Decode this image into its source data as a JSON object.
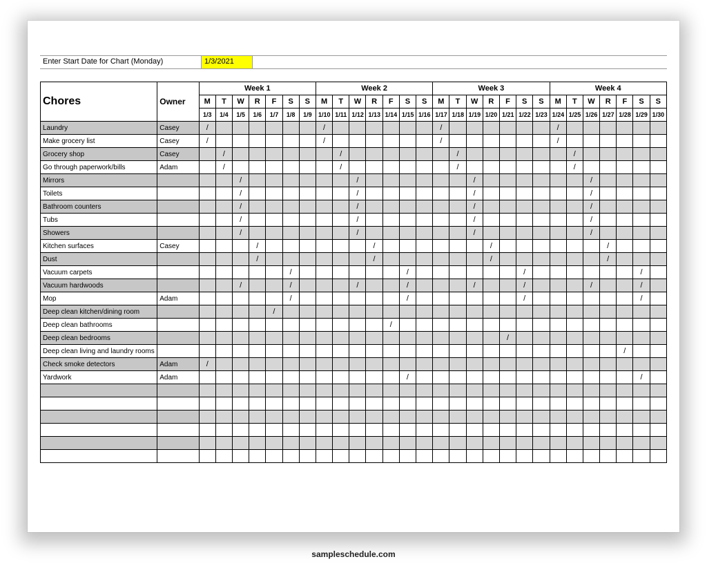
{
  "top": {
    "label": "Enter Start Date for Chart (Monday)",
    "date": "1/3/2021"
  },
  "headers": {
    "chores": "Chores",
    "owner": "Owner",
    "weeks": [
      "Week 1",
      "Week 2",
      "Week 3",
      "Week 4"
    ],
    "day_letters": [
      "M",
      "T",
      "W",
      "R",
      "F",
      "S",
      "S",
      "M",
      "T",
      "W",
      "R",
      "F",
      "S",
      "S",
      "M",
      "T",
      "W",
      "R",
      "F",
      "S",
      "S",
      "M",
      "T",
      "W",
      "R",
      "F",
      "S",
      "S"
    ],
    "day_dates": [
      "1/3",
      "1/4",
      "1/5",
      "1/6",
      "1/7",
      "1/8",
      "1/9",
      "1/10",
      "1/11",
      "1/12",
      "1/13",
      "1/14",
      "1/15",
      "1/16",
      "1/17",
      "1/18",
      "1/19",
      "1/20",
      "1/21",
      "1/22",
      "1/23",
      "1/24",
      "1/25",
      "1/26",
      "1/27",
      "1/28",
      "1/29",
      "1/30"
    ]
  },
  "rows": [
    {
      "chore": "Laundry",
      "owner": "Casey",
      "shaded": true,
      "marks": [
        0,
        7,
        14,
        21
      ]
    },
    {
      "chore": "Make grocery list",
      "owner": "Casey",
      "shaded": false,
      "marks": [
        0,
        7,
        14,
        21
      ]
    },
    {
      "chore": "Grocery shop",
      "owner": "Casey",
      "shaded": true,
      "marks": [
        1,
        8,
        15,
        22
      ]
    },
    {
      "chore": "Go through paperwork/bills",
      "owner": "Adam",
      "shaded": false,
      "marks": [
        1,
        8,
        15,
        22
      ]
    },
    {
      "chore": "Mirrors",
      "owner": "",
      "shaded": true,
      "marks": [
        2,
        9,
        16,
        23
      ]
    },
    {
      "chore": "Toilets",
      "owner": "",
      "shaded": false,
      "marks": [
        2,
        9,
        16,
        23
      ]
    },
    {
      "chore": "Bathroom counters",
      "owner": "",
      "shaded": true,
      "marks": [
        2,
        9,
        16,
        23
      ]
    },
    {
      "chore": "Tubs",
      "owner": "",
      "shaded": false,
      "marks": [
        2,
        9,
        16,
        23
      ]
    },
    {
      "chore": "Showers",
      "owner": "",
      "shaded": true,
      "marks": [
        2,
        9,
        16,
        23
      ]
    },
    {
      "chore": "Kitchen surfaces",
      "owner": "Casey",
      "shaded": false,
      "marks": [
        3,
        10,
        17,
        24
      ]
    },
    {
      "chore": "Dust",
      "owner": "",
      "shaded": true,
      "marks": [
        3,
        10,
        17,
        24
      ]
    },
    {
      "chore": "Vacuum carpets",
      "owner": "",
      "shaded": false,
      "marks": [
        5,
        12,
        19,
        26
      ]
    },
    {
      "chore": "Vacuum hardwoods",
      "owner": "",
      "shaded": true,
      "marks": [
        2,
        5,
        9,
        12,
        16,
        19,
        23,
        26
      ]
    },
    {
      "chore": "Mop",
      "owner": "Adam",
      "shaded": false,
      "marks": [
        5,
        12,
        19,
        26
      ]
    },
    {
      "chore": "Deep clean kitchen/dining room",
      "owner": "",
      "shaded": true,
      "marks": [
        4
      ]
    },
    {
      "chore": "Deep clean bathrooms",
      "owner": "",
      "shaded": false,
      "marks": [
        11
      ]
    },
    {
      "chore": "Deep clean bedrooms",
      "owner": "",
      "shaded": true,
      "marks": [
        18
      ]
    },
    {
      "chore": "Deep clean living and laundry rooms",
      "owner": "",
      "shaded": false,
      "marks": [
        25
      ]
    },
    {
      "chore": "Check smoke detectors",
      "owner": "Adam",
      "shaded": true,
      "marks": [
        0
      ]
    },
    {
      "chore": "Yardwork",
      "owner": "Adam",
      "shaded": false,
      "marks": [
        12,
        26
      ]
    },
    {
      "chore": "",
      "owner": "",
      "shaded": true,
      "marks": []
    },
    {
      "chore": "",
      "owner": "",
      "shaded": false,
      "marks": []
    },
    {
      "chore": "",
      "owner": "",
      "shaded": true,
      "marks": []
    },
    {
      "chore": "",
      "owner": "",
      "shaded": false,
      "marks": []
    },
    {
      "chore": "",
      "owner": "",
      "shaded": true,
      "marks": []
    },
    {
      "chore": "",
      "owner": "",
      "shaded": false,
      "marks": []
    }
  ],
  "mark_symbol": "/",
  "footer": "sampleschedule.com"
}
